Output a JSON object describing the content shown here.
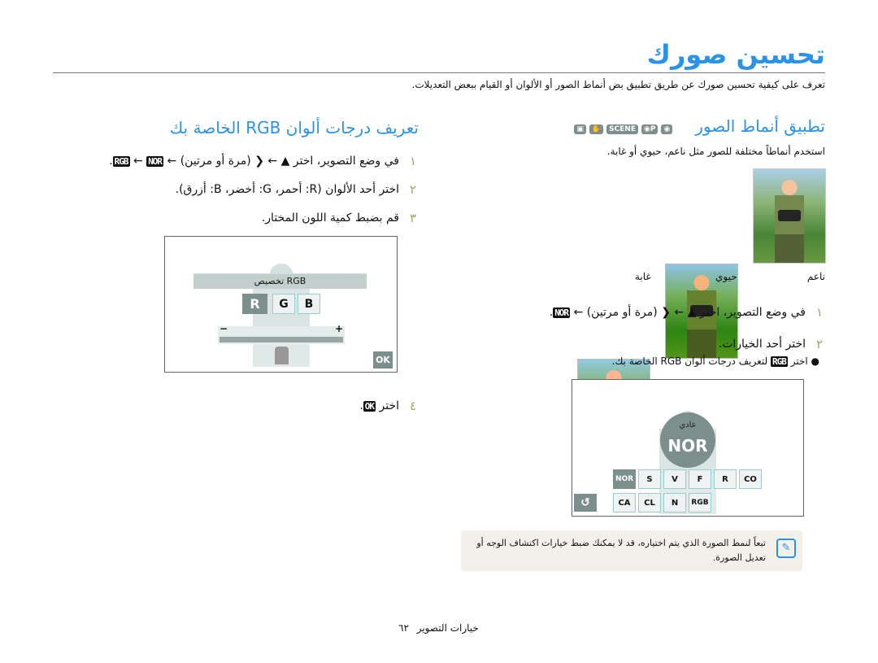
{
  "header": {
    "title": "تحسين صورك",
    "intro": "تعرف على كيفية تحسين صورك عن طريق تطبيق بض أنماط الصور أو الألوان أو القيام ببعض التعديلات."
  },
  "photo_styles": {
    "heading": "تطبيق أنماط الصور",
    "mode_icons": [
      "camera-icon",
      "program-icon",
      "SCENE",
      "dual-is-icon",
      "movie-icon"
    ],
    "description": "استخدم أنماطاً مختلفة للصور مثل ناعم، حيوي أو غابة.",
    "samples": [
      {
        "label": "ناعم"
      },
      {
        "label": "حيوي"
      },
      {
        "label": "غابة"
      }
    ],
    "steps": [
      {
        "num": "١",
        "text": "في وضع التصوير، اختر",
        "arrow": "←",
        "paren": "(مرة أو مرتين) ←",
        "icon": "NOR",
        "end": "."
      },
      {
        "num": "٢",
        "text": "اختر أحد الخيارات."
      }
    ],
    "bullet": {
      "pre": "اختر",
      "icon": "RGB",
      "post": "لتعريف درجات ألوان RGB الخاصة بك."
    },
    "screen": {
      "label": "عادي",
      "big_icon": "NOR",
      "options_row1": [
        "NOR",
        "S",
        "V",
        "F",
        "R",
        "CO"
      ],
      "options_row2": [
        "CA",
        "CL",
        "N",
        "RGB"
      ],
      "selected": "NOR",
      "back_icon": "back-icon"
    }
  },
  "rgb": {
    "heading": "تعريف درجات ألوان RGB الخاصة بك",
    "steps": [
      {
        "num": "١",
        "text": "في وضع التصوير، اختر",
        "arrow": "←",
        "paren": "(مرة أو مرتين) ←",
        "icon1": "NOR",
        "sep": "←",
        "icon2": "RGB",
        "end": "."
      },
      {
        "num": "٢",
        "text": "اختر أحد الألوان (R: أحمر، G: أخضر، B: أزرق)."
      },
      {
        "num": "٣",
        "text": "قم بضبط كمية اللون المختار."
      },
      {
        "num": "٤",
        "text": "اختر",
        "icon": "OK",
        "end": "."
      }
    ],
    "screen": {
      "title": "تخصيص RGB",
      "channels": [
        "R",
        "G",
        "B"
      ],
      "selected": "R",
      "minus": "−",
      "plus": "+",
      "ok": "OK",
      "slider_value": 0.5
    }
  },
  "note": {
    "text": "تبعاً لنمط الصورة الذي يتم اختياره، قد لا يمكنك ضبط خيارات اكتشاف الوجه أو تعديل الصورة.",
    "icon": "note-icon"
  },
  "footer": {
    "section": "خيارات التصوير",
    "page": "٦٢"
  },
  "colors": {
    "accent": "#2a93e8",
    "step_number": "#a4a46a",
    "screen_gray": "#7d8f8c",
    "note_bg": "#f3f0ea"
  }
}
